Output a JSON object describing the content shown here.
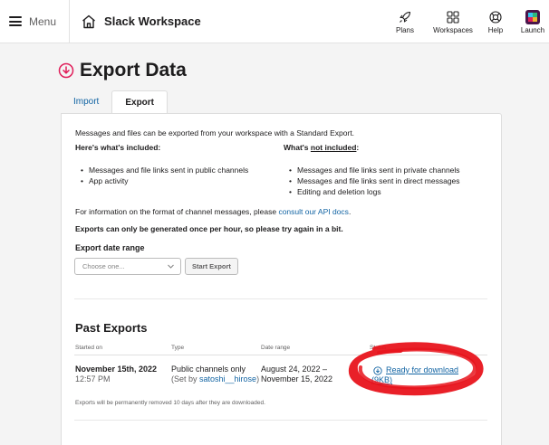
{
  "topbar": {
    "menu_label": "Menu",
    "workspace_name": "Slack Workspace",
    "actions": [
      {
        "label": "Plans",
        "icon": "rocket-icon"
      },
      {
        "label": "Workspaces",
        "icon": "grid-icon"
      },
      {
        "label": "Help",
        "icon": "lifebuoy-icon"
      },
      {
        "label": "Launch",
        "icon": "slack-logo-icon"
      }
    ]
  },
  "page": {
    "title": "Export Data",
    "tabs": [
      {
        "label": "Import",
        "active": false
      },
      {
        "label": "Export",
        "active": true
      }
    ]
  },
  "export": {
    "intro": "Messages and files can be exported from your workspace with a Standard Export.",
    "included_heading": "Here's what's included:",
    "not_included_prefix": "What's ",
    "not_included_emph": "not included",
    "not_included_suffix": ":",
    "included": [
      "Messages and file links sent in public channels",
      "App activity"
    ],
    "not_included": [
      "Messages and file links sent in private channels",
      "Messages and file links sent in direct messages",
      "Editing and deletion logs"
    ],
    "info_prefix": "For information on the format of channel messages, please ",
    "info_link": "consult our API docs",
    "info_suffix": ".",
    "rate_limit": "Exports can only be generated once per hour, so please try again in a bit.",
    "date_range_label": "Export date range",
    "date_range_placeholder": "Choose one...",
    "start_button": "Start Export"
  },
  "past_exports": {
    "title": "Past Exports",
    "columns": [
      "Started on",
      "Type",
      "Date range",
      "Status"
    ],
    "rows": [
      {
        "started_date": "November 15th, 2022",
        "started_time": "12:57 PM",
        "type": "Public channels only",
        "set_by_prefix": "(Set by ",
        "set_by_user": "satoshi__hirose",
        "set_by_suffix": ")",
        "range_start": "August 24, 2022 –",
        "range_end": "November 15, 2022",
        "status": "Ready for download",
        "size": "(9KB)"
      }
    ],
    "retention_note": "Exports will be permanently removed 10 days after they are downloaded."
  },
  "colors": {
    "link": "#1264a3",
    "annotation": "#e8141c",
    "alert_icon": "#e01e5a"
  }
}
